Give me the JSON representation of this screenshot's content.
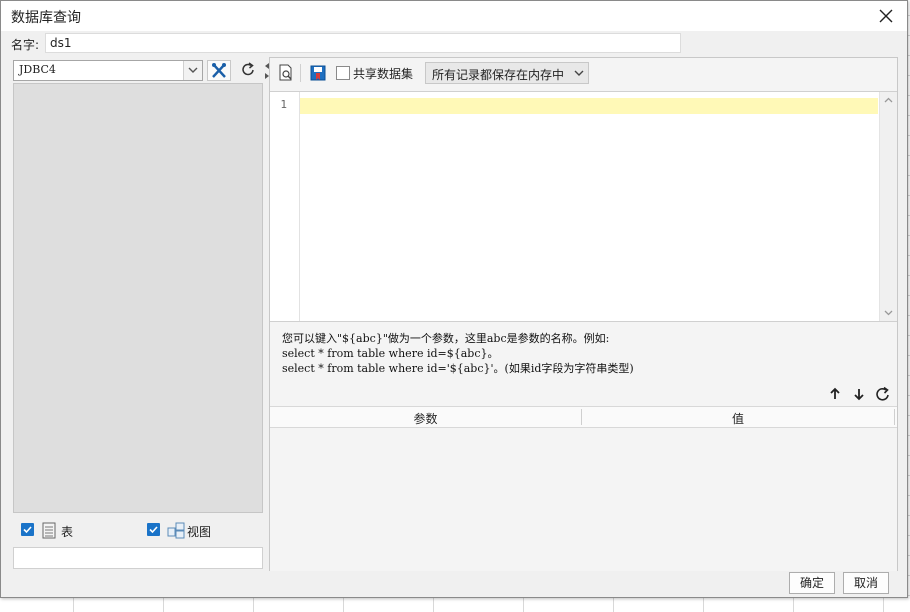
{
  "dialog": {
    "title": "数据库查询"
  },
  "name_row": {
    "label": "名字:",
    "value": "ds1"
  },
  "left": {
    "datasource": "JDBC4",
    "checks": [
      {
        "label": "表",
        "checked": true,
        "icon": "table-icon"
      },
      {
        "label": "视图",
        "checked": true,
        "icon": "view-icon"
      }
    ]
  },
  "toolbar": {
    "share_label": "共享数据集",
    "share_checked": false,
    "store_option": "所有记录都保存在内存中"
  },
  "editor": {
    "line_numbers": [
      "1"
    ],
    "content": ""
  },
  "hint": {
    "line1": "您可以键入\"${abc}\"做为一个参数，这里abc是参数的名称。例如:",
    "line2": "select * from table where id=${abc}。",
    "line3": "select * from table where id='${abc}'。(如果id字段为字符串类型)"
  },
  "params": {
    "columns": [
      "参数",
      "值"
    ],
    "rows": []
  },
  "footer": {
    "ok": "确定",
    "cancel": "取消"
  },
  "colors": {
    "accent": "#1a73c8",
    "active_line": "#fff9b7",
    "tree_bg": "#dedede"
  }
}
